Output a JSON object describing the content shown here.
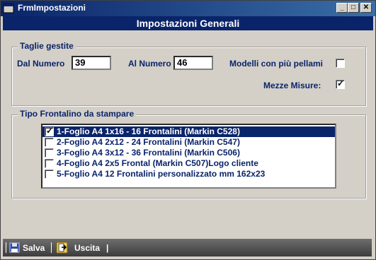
{
  "window": {
    "title": "FrmImpostazioni",
    "buttons": {
      "minimize": "_",
      "maximize": "□",
      "close": "✕"
    }
  },
  "header": {
    "title": "Impostazioni Generali"
  },
  "taglie": {
    "legend": "Taglie gestite",
    "dal_label": "Dal Numero",
    "dal_value": "39",
    "al_label": "Al Numero",
    "al_value": "46",
    "modelli_label": "Modelli con più pellami",
    "modelli_checked": false,
    "mezze_label": "Mezze Misure:",
    "mezze_checked": true
  },
  "frontalino": {
    "legend": "Tipo Frontalino da stampare",
    "items": [
      {
        "label": "1-Foglio A4 1x16 - 16 Frontalini (Markin C528)",
        "checked": true,
        "selected": true
      },
      {
        "label": "2-Foglio A4 2x12 - 24 Frontalini (Markin C547)",
        "checked": false,
        "selected": false
      },
      {
        "label": "3-Foglio A4 3x12 - 36 Frontalini (Markin C506)",
        "checked": false,
        "selected": false
      },
      {
        "label": "4-Foglio A4 2x5 Frontal (Markin C507)Logo cliente",
        "checked": false,
        "selected": false
      },
      {
        "label": "5-Foglio A4 12 Frontalini personalizzato mm 162x23",
        "checked": false,
        "selected": false
      }
    ]
  },
  "toolbar": {
    "save_label": "Salva",
    "exit_label": "Uscita",
    "separator": "|"
  },
  "colors": {
    "accent": "#0a246a",
    "background": "#d4d0c8"
  }
}
